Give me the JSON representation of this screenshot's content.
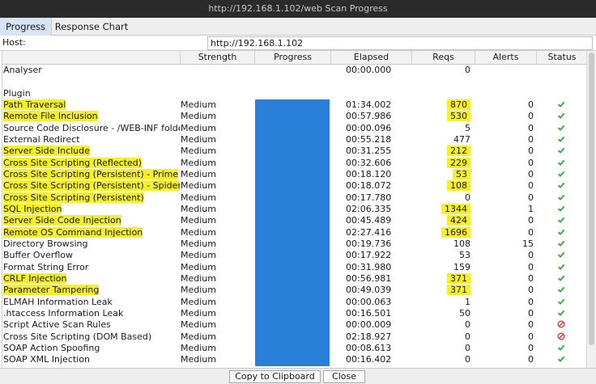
{
  "window": {
    "title": "http://192.168.1.102/web Scan Progress"
  },
  "tabs": [
    {
      "label": "Progress",
      "active": true
    },
    {
      "label": "Response Chart",
      "active": false
    }
  ],
  "host": {
    "label": "Host:",
    "value": "http://192.168.1.102"
  },
  "columns": [
    "Strength",
    "Progress",
    "Elapsed",
    "Reqs",
    "Alerts",
    "Status"
  ],
  "analyser": {
    "label": "Analyser",
    "elapsed": "00:00.000",
    "reqs": "0"
  },
  "plugin_label": "Plugin",
  "rows": [
    {
      "name": "Path Traversal",
      "strength": "Medium",
      "progress": 1,
      "elapsed": "01:34.002",
      "reqs": "870",
      "alerts": "0",
      "status": "complete",
      "hl_name": true,
      "hl_reqs": true
    },
    {
      "name": "Remote File Inclusion",
      "strength": "Medium",
      "progress": 1,
      "elapsed": "00:57.986",
      "reqs": "530",
      "alerts": "0",
      "status": "complete",
      "hl_name": true,
      "hl_reqs": true
    },
    {
      "name": "Source Code Disclosure - /WEB-INF folder",
      "strength": "Medium",
      "progress": 1,
      "elapsed": "00:00.096",
      "reqs": "5",
      "alerts": "0",
      "status": "complete",
      "hl_name": false,
      "hl_reqs": false
    },
    {
      "name": "External Redirect",
      "strength": "Medium",
      "progress": 1,
      "elapsed": "00:55.218",
      "reqs": "477",
      "alerts": "0",
      "status": "complete",
      "hl_name": false,
      "hl_reqs": false
    },
    {
      "name": "Server Side Include",
      "strength": "Medium",
      "progress": 1,
      "elapsed": "00:31.255",
      "reqs": "212",
      "alerts": "0",
      "status": "complete",
      "hl_name": true,
      "hl_reqs": true
    },
    {
      "name": "Cross Site Scripting (Reflected)",
      "strength": "Medium",
      "progress": 1,
      "elapsed": "00:32.606",
      "reqs": "229",
      "alerts": "0",
      "status": "complete",
      "hl_name": true,
      "hl_reqs": true
    },
    {
      "name": "Cross Site Scripting (Persistent) - Prime",
      "strength": "Medium",
      "progress": 1,
      "elapsed": "00:18.120",
      "reqs": "53",
      "alerts": "0",
      "status": "complete",
      "hl_name": true,
      "hl_reqs": true
    },
    {
      "name": "Cross Site Scripting (Persistent) - Spider",
      "strength": "Medium",
      "progress": 1,
      "elapsed": "00:18.072",
      "reqs": "108",
      "alerts": "0",
      "status": "complete",
      "hl_name": true,
      "hl_reqs": true
    },
    {
      "name": "Cross Site Scripting (Persistent)",
      "strength": "Medium",
      "progress": 1,
      "elapsed": "00:17.780",
      "reqs": "0",
      "alerts": "0",
      "status": "complete",
      "hl_name": true,
      "hl_reqs": false
    },
    {
      "name": "SQL Injection",
      "strength": "Medium",
      "progress": 1,
      "elapsed": "02:06.335",
      "reqs": "1344",
      "alerts": "1",
      "status": "complete",
      "hl_name": true,
      "hl_reqs": true
    },
    {
      "name": "Server Side Code Injection",
      "strength": "Medium",
      "progress": 1,
      "elapsed": "00:45.489",
      "reqs": "424",
      "alerts": "0",
      "status": "complete",
      "hl_name": true,
      "hl_reqs": true
    },
    {
      "name": "Remote OS Command Injection",
      "strength": "Medium",
      "progress": 1,
      "elapsed": "02:27.416",
      "reqs": "1696",
      "alerts": "0",
      "status": "complete",
      "hl_name": true,
      "hl_reqs": true
    },
    {
      "name": "Directory Browsing",
      "strength": "Medium",
      "progress": 1,
      "elapsed": "00:19.736",
      "reqs": "108",
      "alerts": "15",
      "status": "complete",
      "hl_name": false,
      "hl_reqs": false
    },
    {
      "name": "Buffer Overflow",
      "strength": "Medium",
      "progress": 1,
      "elapsed": "00:17.922",
      "reqs": "53",
      "alerts": "0",
      "status": "complete",
      "hl_name": false,
      "hl_reqs": false
    },
    {
      "name": "Format String Error",
      "strength": "Medium",
      "progress": 1,
      "elapsed": "00:31.980",
      "reqs": "159",
      "alerts": "0",
      "status": "complete",
      "hl_name": false,
      "hl_reqs": false
    },
    {
      "name": "CRLF Injection",
      "strength": "Medium",
      "progress": 1,
      "elapsed": "00:56.981",
      "reqs": "371",
      "alerts": "0",
      "status": "complete",
      "hl_name": true,
      "hl_reqs": true
    },
    {
      "name": "Parameter Tampering",
      "strength": "Medium",
      "progress": 1,
      "elapsed": "00:49.039",
      "reqs": "371",
      "alerts": "0",
      "status": "complete",
      "hl_name": true,
      "hl_reqs": true
    },
    {
      "name": "ELMAH Information Leak",
      "strength": "Medium",
      "progress": 1,
      "elapsed": "00:00.063",
      "reqs": "1",
      "alerts": "0",
      "status": "complete",
      "hl_name": false,
      "hl_reqs": false
    },
    {
      "name": ".htaccess Information Leak",
      "strength": "Medium",
      "progress": 1,
      "elapsed": "00:16.501",
      "reqs": "50",
      "alerts": "0",
      "status": "complete",
      "hl_name": false,
      "hl_reqs": false
    },
    {
      "name": "Script Active Scan Rules",
      "strength": "Medium",
      "progress": 1,
      "elapsed": "00:00.009",
      "reqs": "0",
      "alerts": "0",
      "status": "skipped",
      "hl_name": false,
      "hl_reqs": false
    },
    {
      "name": "Cross Site Scripting (DOM Based)",
      "strength": "Medium",
      "progress": 1,
      "elapsed": "02:18.927",
      "reqs": "0",
      "alerts": "0",
      "status": "skipped",
      "hl_name": false,
      "hl_reqs": false
    },
    {
      "name": "SOAP Action Spoofing",
      "strength": "Medium",
      "progress": 1,
      "elapsed": "00:08.613",
      "reqs": "0",
      "alerts": "0",
      "status": "complete",
      "hl_name": false,
      "hl_reqs": false
    },
    {
      "name": "SOAP XML Injection",
      "strength": "Medium",
      "progress": 1,
      "elapsed": "00:16.402",
      "reqs": "0",
      "alerts": "0",
      "status": "complete",
      "hl_name": false,
      "hl_reqs": false
    }
  ],
  "icons": {
    "complete": "check-icon",
    "skipped": "cancel-icon"
  },
  "colors": {
    "progress_bar": "#2a7fd8",
    "highlight": "#f5f02a",
    "check": "#2fa82f",
    "cancel": "#d93a2f"
  },
  "buttons": {
    "copy": "Copy to Clipboard",
    "close": "Close"
  }
}
